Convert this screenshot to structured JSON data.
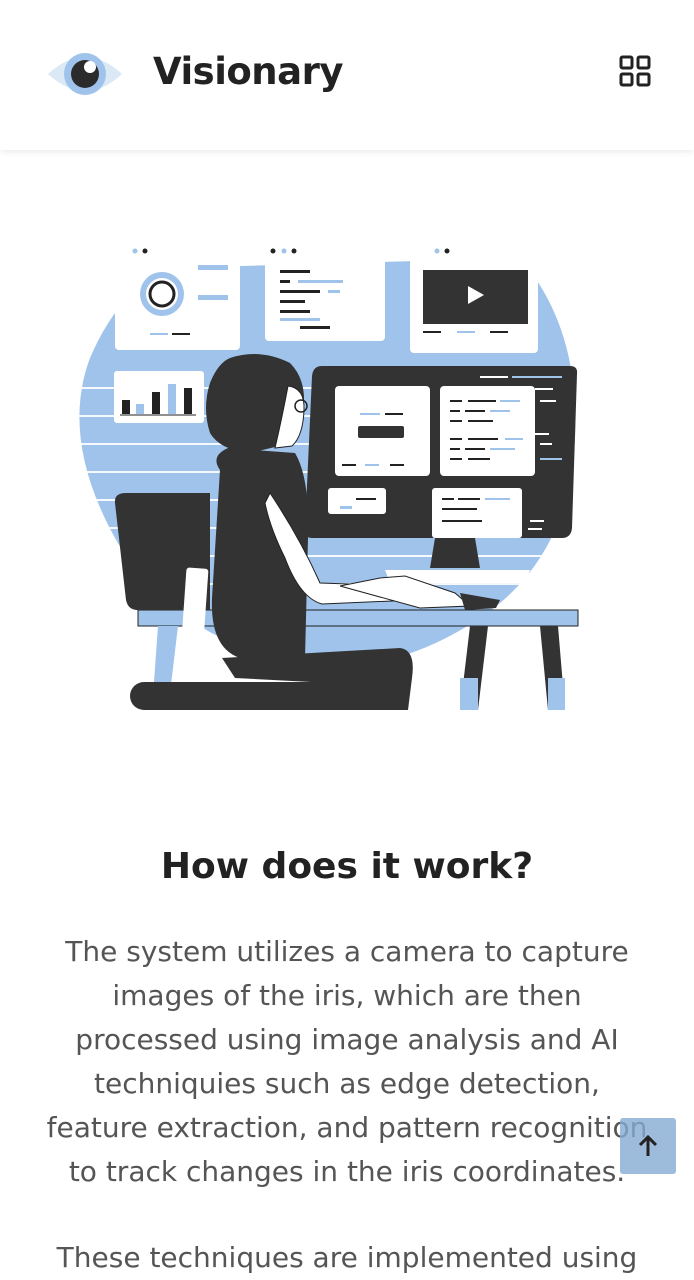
{
  "header": {
    "brand": "Visionary",
    "logo_icon": "eye-icon",
    "menu_icon": "grid-icon"
  },
  "content": {
    "heading": "How does it work?",
    "paragraph1": "The system utilizes a camera to capture images of the iris, which are then processed using image analysis and AI techniquies such as edge detection, feature extraction, and pattern recognition to track changes in the iris coordinates.",
    "paragraph2": "These techniques are implemented using"
  },
  "scroll_top_icon": "arrow-up-icon",
  "colors": {
    "accent": "#9fc3ea",
    "dark": "#333333",
    "text": "#555555",
    "heading": "#222222"
  }
}
